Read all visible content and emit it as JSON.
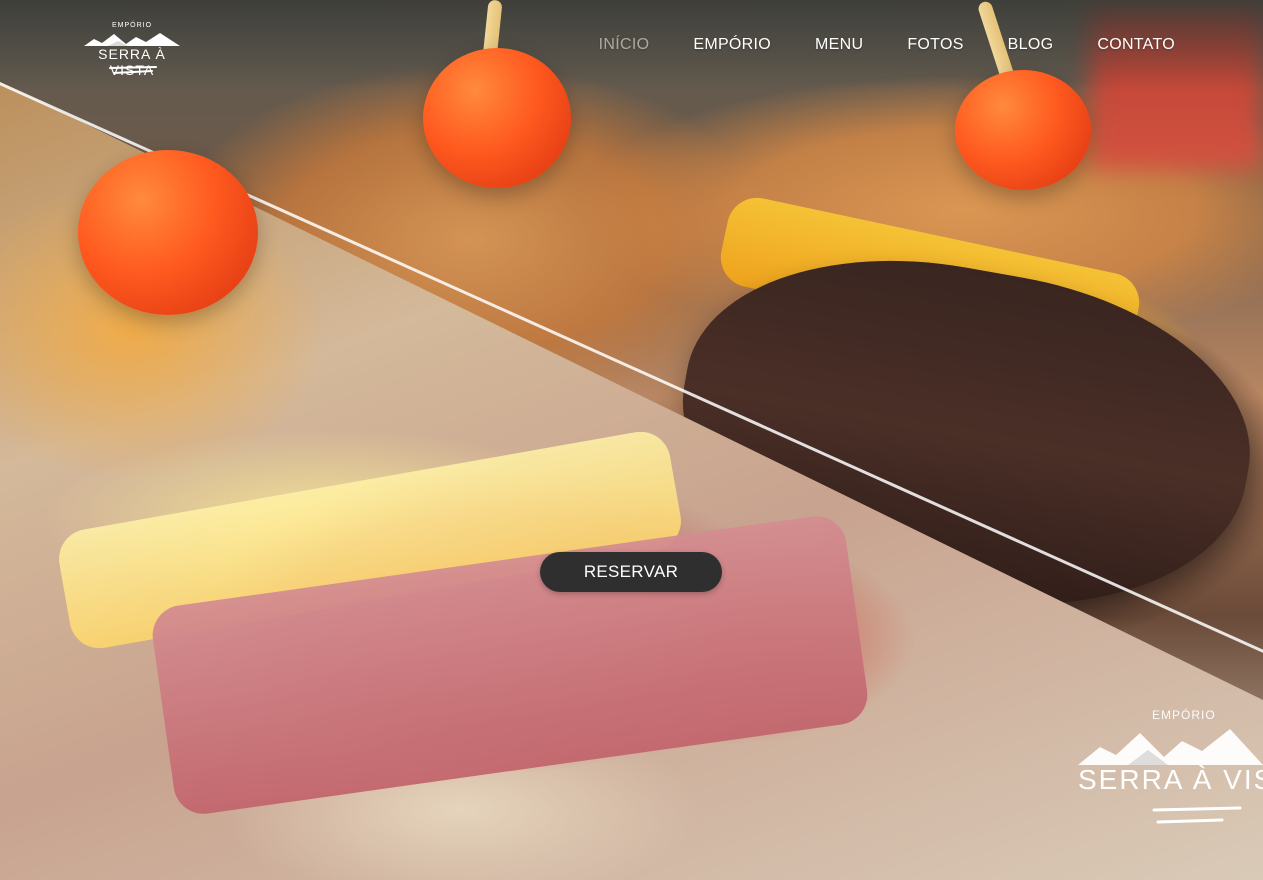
{
  "brand": {
    "small": "EMPÓRIO",
    "name": "SERRA À VISTA"
  },
  "nav": {
    "items": [
      {
        "label": "INÍCIO",
        "active": true
      },
      {
        "label": "EMPÓRIO",
        "active": false
      },
      {
        "label": "MENU",
        "active": false
      },
      {
        "label": "FOTOS",
        "active": false
      },
      {
        "label": "BLOG",
        "active": false
      },
      {
        "label": "CONTATO",
        "active": false
      }
    ]
  },
  "hero": {
    "reserve_label": "RESERVAR"
  },
  "watermark": {
    "small": "EMPÓRIO",
    "name": "SERRA À VIS"
  },
  "colors": {
    "button_bg": "#2f2f2f",
    "nav_text": "#ffffff",
    "nav_active": "#cfc8bd"
  }
}
